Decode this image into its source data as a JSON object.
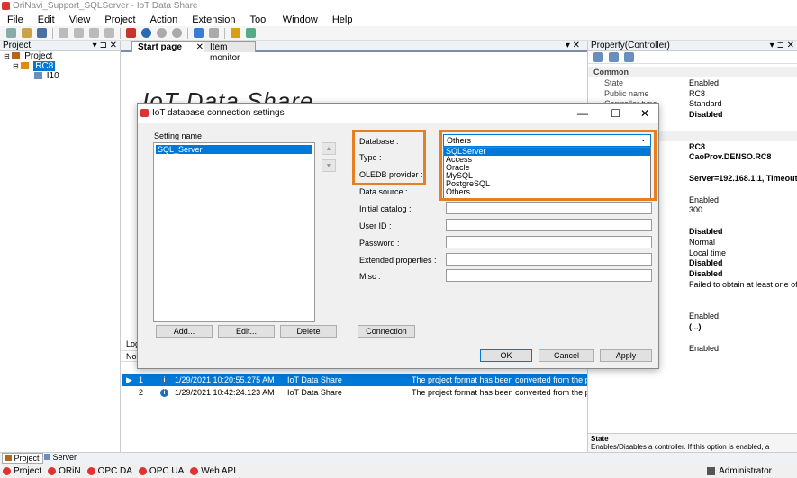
{
  "window": {
    "title": "OriNavi_Support_SQLServer - IoT Data Share"
  },
  "menu": [
    "File",
    "Edit",
    "View",
    "Project",
    "Action",
    "Extension",
    "Tool",
    "Window",
    "Help"
  ],
  "project_panel": {
    "title": "Project",
    "controls": "▾ ⊐ ✕",
    "tree": {
      "root": "Project",
      "controller": "RC8",
      "child": "I10"
    }
  },
  "doc_tabs": {
    "start": "Start page",
    "monitor": "Item monitor",
    "close": "✕",
    "controls": "▾ ✕"
  },
  "banner": "IoT Data Share",
  "property_panel": {
    "title": "Property(Controller)",
    "controls": "▾ ⊐ ✕",
    "rows": [
      {
        "k": "Common",
        "v": "",
        "group": true
      },
      {
        "k": "State",
        "v": "Enabled"
      },
      {
        "k": "Public name",
        "v": "RC8"
      },
      {
        "k": "Controller type",
        "v": "Standard"
      },
      {
        "k": "",
        "v": "Disabled"
      },
      {
        "k": "",
        "v": ""
      },
      {
        "k": "troller)",
        "v": "",
        "group": true
      },
      {
        "k": "",
        "v": "RC8"
      },
      {
        "k": "",
        "v": "CaoProv.DENSO.RC8"
      },
      {
        "k": "",
        "v": ""
      },
      {
        "k": "",
        "v": "Server=192.168.1.1, Timeout="
      },
      {
        "k": "",
        "v": ""
      },
      {
        "k": "ing",
        "v": "Enabled"
      },
      {
        "k": "",
        "v": "300"
      },
      {
        "k": "",
        "v": ""
      },
      {
        "k": "",
        "v": "Disabled"
      },
      {
        "k": "",
        "v": "Normal"
      },
      {
        "k": "",
        "v": "Local time"
      },
      {
        "k": "",
        "v": "Disabled"
      },
      {
        "k": "",
        "v": "Disabled"
      },
      {
        "k": "ction",
        "v": "Failed to obtain at least one of ite"
      },
      {
        "k": "nection",
        "v": ""
      },
      {
        "k": "",
        "v": ""
      },
      {
        "k": "",
        "v": "Enabled"
      },
      {
        "k": "ttings",
        "v": "(...)"
      },
      {
        "k": "",
        "v": ""
      },
      {
        "k": "tory",
        "v": "Enabled"
      }
    ],
    "description": {
      "title": "State",
      "text": "Enables/Disables a controller. If this option is enabled, a controller becomes available in the ORiN interface-supporte..."
    }
  },
  "log": {
    "title": "Log",
    "no_header": "No",
    "rows": [
      {
        "no": "1",
        "time": "1/29/2021 10:20:55.275 AM",
        "source": "IoT Data Share",
        "message": "The project format has been converted from the past"
      },
      {
        "no": "2",
        "time": "1/29/2021 10:42:24.123 AM",
        "source": "IoT Data Share",
        "message": "The project format has been converted from the past"
      }
    ]
  },
  "bottom_tabs": {
    "project": "Project",
    "server": "Server"
  },
  "status": {
    "items": [
      "Project",
      "ORiN",
      "OPC DA",
      "OPC UA",
      "Web API"
    ],
    "user": "Administrator"
  },
  "dialog": {
    "title": "IoT database connection settings",
    "minimize": "—",
    "maximize": "☐",
    "close": "✕",
    "setting_name_label": "Setting name",
    "setting_item": "SQL_Server",
    "up_arrow": "▲",
    "down_arrow": "▼",
    "buttons": {
      "add": "Add...",
      "edit": "Edit...",
      "delete": "Delete",
      "connection": "Connection",
      "ok": "OK",
      "cancel": "Cancel",
      "apply": "Apply"
    },
    "labels": {
      "database": "Database :",
      "type": "Type :",
      "oledb": "OLEDB provider :",
      "datasource": "Data source :",
      "catalog": "Initial catalog :",
      "userid": "User ID :",
      "password": "Password :",
      "extended": "Extended properties :",
      "misc": "Misc :"
    },
    "database_value": "Others",
    "database_options": [
      "SQLServer",
      "Access",
      "Oracle",
      "MySQL",
      "PostgreSQL",
      "Others"
    ],
    "dropdown_arrow": "⌄"
  },
  "colors": {
    "highlight": "#e67e22",
    "selection": "#0078d7"
  }
}
